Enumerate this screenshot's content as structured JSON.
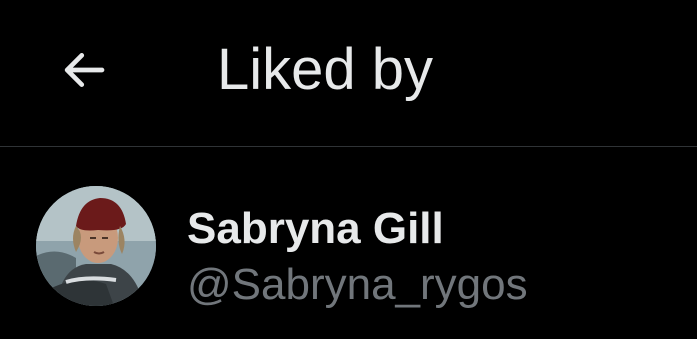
{
  "colors": {
    "background": "#000000",
    "primary_text": "#e7e9ea",
    "secondary_text": "#71767b",
    "divider": "#2f3336"
  },
  "header": {
    "back_icon": "arrow-left-icon",
    "title": "Liked by"
  },
  "users": [
    {
      "display_name": "Sabryna Gill",
      "handle": "@Sabryna_rygos",
      "avatar_icon": "avatar-photo"
    }
  ]
}
